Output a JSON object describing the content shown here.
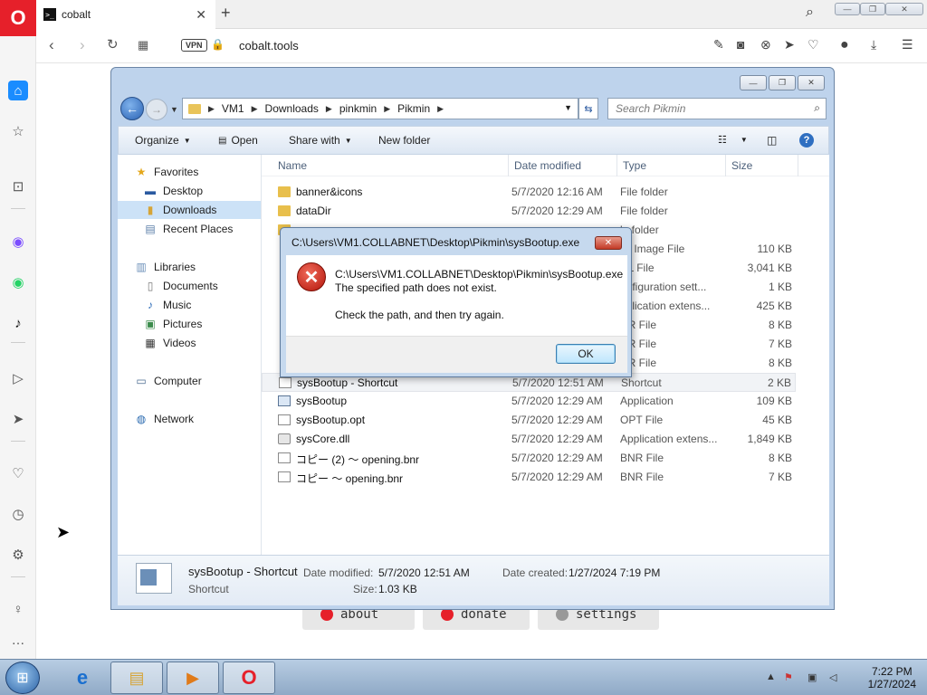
{
  "browser": {
    "tab_title": "cobalt",
    "tab_favicon": ">_",
    "url": "cobalt.tools",
    "vpn_label": "VPN",
    "icons": [
      "back-arrow-icon",
      "forward-arrow-icon",
      "reload-icon",
      "tabs-grid-icon",
      "edit-icon",
      "camera-icon",
      "block-icon",
      "send-icon",
      "heart-icon",
      "profile-icon",
      "download-icon",
      "menu-icon",
      "search-icon"
    ]
  },
  "page": {
    "buttons": [
      {
        "label": "about",
        "dot_color": "#e6202a"
      },
      {
        "label": "donate",
        "dot_color": "#e6202a"
      },
      {
        "label": "settings",
        "dot_color": "#999999"
      }
    ]
  },
  "explorer": {
    "breadcrumb": [
      "VM1",
      "Downloads",
      "pinkmin",
      "Pikmin"
    ],
    "search_placeholder": "Search Pikmin",
    "toolbar": {
      "organize": "Organize",
      "open": "Open",
      "share_with": "Share with",
      "new_folder": "New folder"
    },
    "nav": {
      "favorites": "Favorites",
      "desktop": "Desktop",
      "downloads": "Downloads",
      "recent_places": "Recent Places",
      "libraries": "Libraries",
      "documents": "Documents",
      "music": "Music",
      "pictures": "Pictures",
      "videos": "Videos",
      "computer": "Computer",
      "network": "Network"
    },
    "columns": {
      "name": "Name",
      "date": "Date modified",
      "type": "Type",
      "size": "Size"
    },
    "files": [
      {
        "name": "banner&icons",
        "date": "5/7/2020 12:16 AM",
        "type": "File folder",
        "size": ""
      },
      {
        "name": "dataDir",
        "date": "5/7/2020 12:29 AM",
        "type": "File folder",
        "size": ""
      },
      {
        "name": "",
        "date": "",
        "type": "le folder",
        "size": ""
      },
      {
        "name": "",
        "date": "",
        "type": "sc Image File",
        "size": "110 KB"
      },
      {
        "name": "",
        "date": "",
        "type": "DL File",
        "size": "3,041 KB"
      },
      {
        "name": "",
        "date": "",
        "type": "onfiguration sett...",
        "size": "1 KB"
      },
      {
        "name": "",
        "date": "",
        "type": "pplication extens...",
        "size": "425 KB"
      },
      {
        "name": "",
        "date": "",
        "type": "NR File",
        "size": "8 KB"
      },
      {
        "name": "",
        "date": "",
        "type": "NR File",
        "size": "7 KB"
      },
      {
        "name": "",
        "date": "",
        "type": "NR File",
        "size": "8 KB"
      },
      {
        "name": "sysBootup - Shortcut",
        "date": "5/7/2020 12:51 AM",
        "type": "Shortcut",
        "size": "2 KB"
      },
      {
        "name": "sysBootup",
        "date": "5/7/2020 12:29 AM",
        "type": "Application",
        "size": "109 KB"
      },
      {
        "name": "sysBootup.opt",
        "date": "5/7/2020 12:29 AM",
        "type": "OPT File",
        "size": "45 KB"
      },
      {
        "name": "sysCore.dll",
        "date": "5/7/2020 12:29 AM",
        "type": "Application extens...",
        "size": "1,849 KB"
      },
      {
        "name": "コピー (2) ～ opening.bnr",
        "date": "5/7/2020 12:29 AM",
        "type": "BNR File",
        "size": "8 KB"
      },
      {
        "name": "コピー ～ opening.bnr",
        "date": "5/7/2020 12:29 AM",
        "type": "BNR File",
        "size": "7 KB"
      }
    ],
    "details": {
      "name": "sysBootup - Shortcut",
      "kind": "Shortcut",
      "modified_label": "Date modified:",
      "modified_value": "5/7/2020 12:51 AM",
      "created_label": "Date created:",
      "created_value": "1/27/2024 7:19 PM",
      "size_label": "Size:",
      "size_value": "1.03 KB"
    }
  },
  "dialog": {
    "title": "C:\\Users\\VM1.COLLABNET\\Desktop\\Pikmin\\sysBootup.exe",
    "line1": "C:\\Users\\VM1.COLLABNET\\Desktop\\Pikmin\\sysBootup.exe",
    "line2": "The specified path does not exist.",
    "line3": "Check the path, and then try again.",
    "ok_label": "OK"
  },
  "taskbar": {
    "time": "7:22 PM",
    "date": "1/27/2024"
  }
}
